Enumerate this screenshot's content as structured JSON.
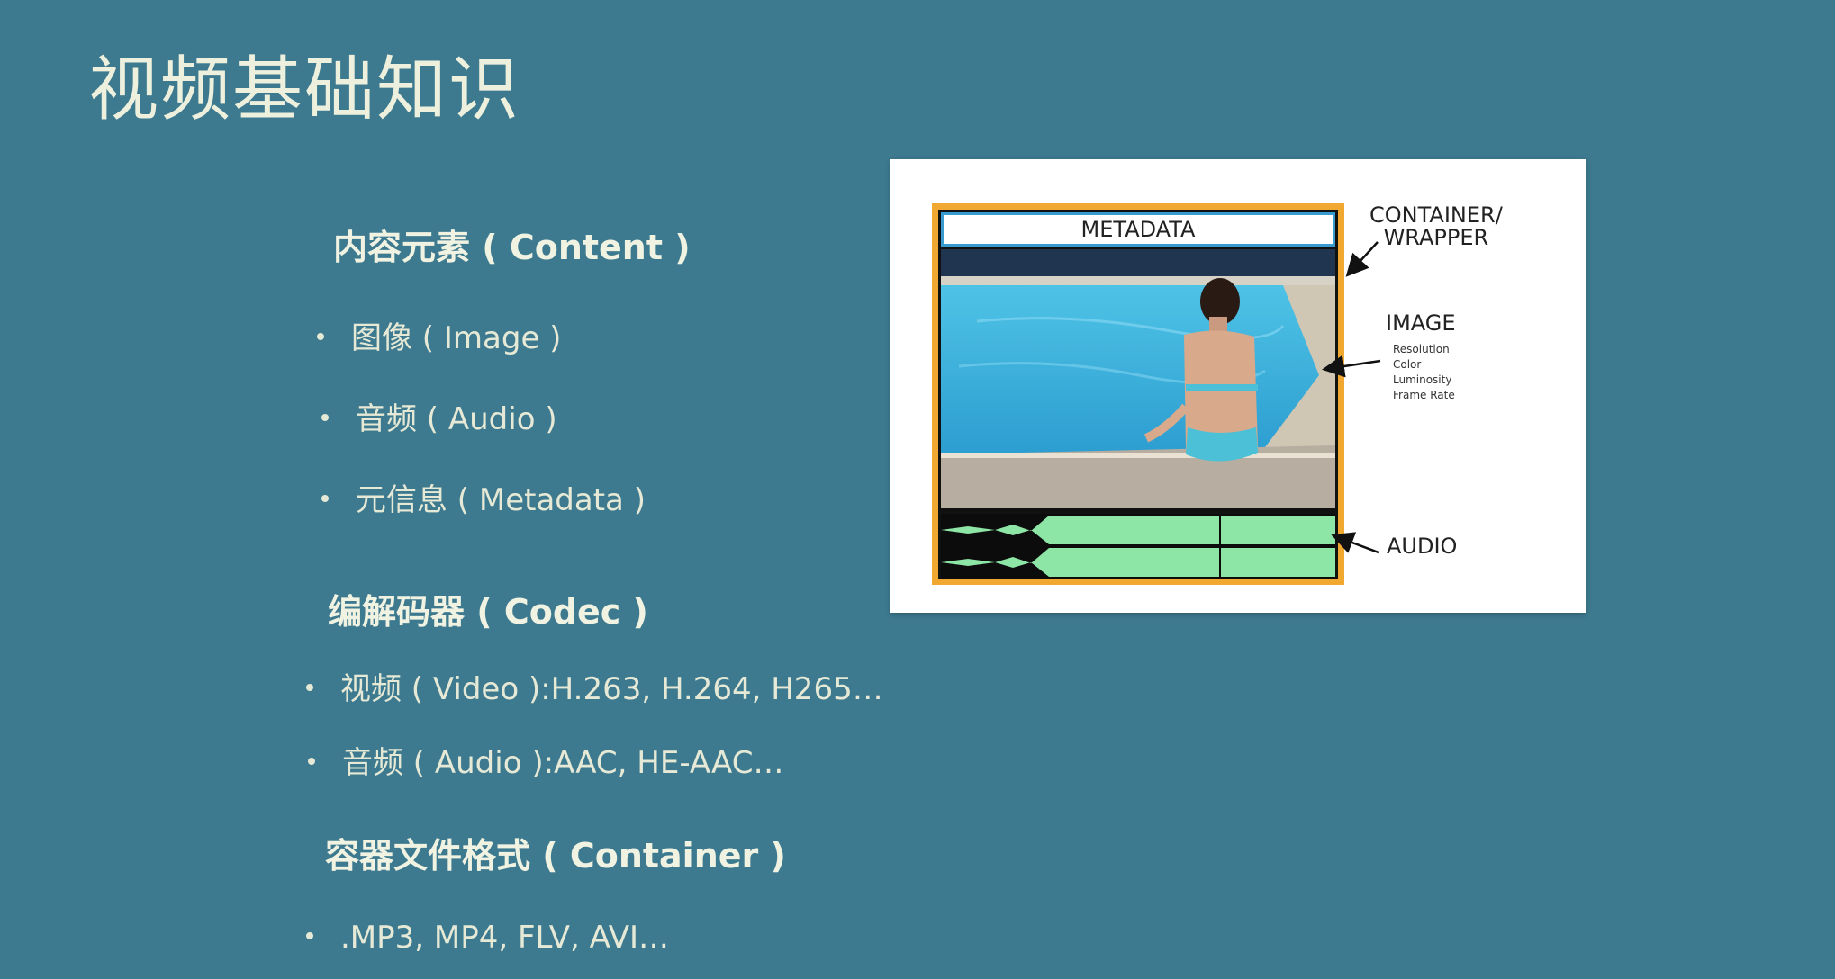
{
  "slide": {
    "title": "视频基础知识"
  },
  "content_section": {
    "heading": "内容元素 ( Content )",
    "items": [
      "图像 ( Image )",
      "音频 ( Audio )",
      "元信息 ( Metadata )"
    ]
  },
  "codec_section": {
    "heading": "编解码器 ( Codec )",
    "items": [
      "视频 ( Video ):H.263, H.264, H265…",
      "音频 ( Audio ):AAC, HE-AAC…"
    ]
  },
  "container_section": {
    "heading": "容器文件格式 ( Container )",
    "items": [
      ".MP3, MP4,  FLV, AVI…"
    ]
  },
  "diagram": {
    "metadata_label": "METADATA",
    "container_label_line1": "CONTAINER/",
    "container_label_line2": "WRAPPER",
    "image_label": "IMAGE",
    "image_details": [
      "Resolution",
      "Color",
      "Luminosity",
      "Frame Rate"
    ],
    "audio_label": "AUDIO"
  },
  "colors": {
    "background": "#3d7a8f",
    "frame_border": "#f0a830",
    "metadata_border": "#3a9bd0",
    "waveform": "#8de6a6"
  }
}
